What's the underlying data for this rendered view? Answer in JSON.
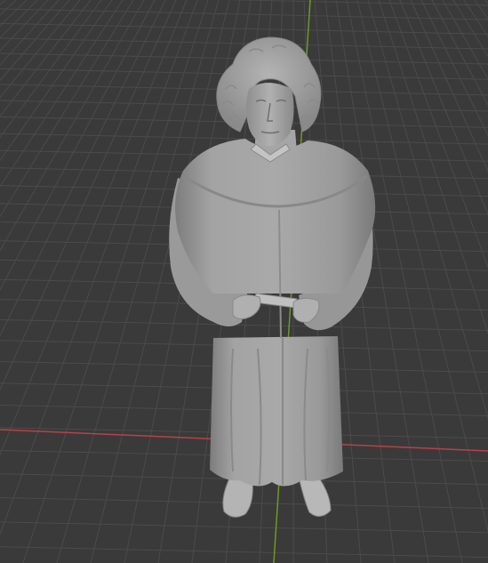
{
  "app": {
    "editor": "3D Viewport",
    "shading": "solid"
  },
  "colors": {
    "background": "#3a3a3a",
    "grid_line": "#4a4a4a",
    "x_axis": "#b8414b",
    "y_axis": "#6c9a24",
    "model": "#9c9c9c"
  },
  "scene": {
    "object": "statue-model"
  }
}
